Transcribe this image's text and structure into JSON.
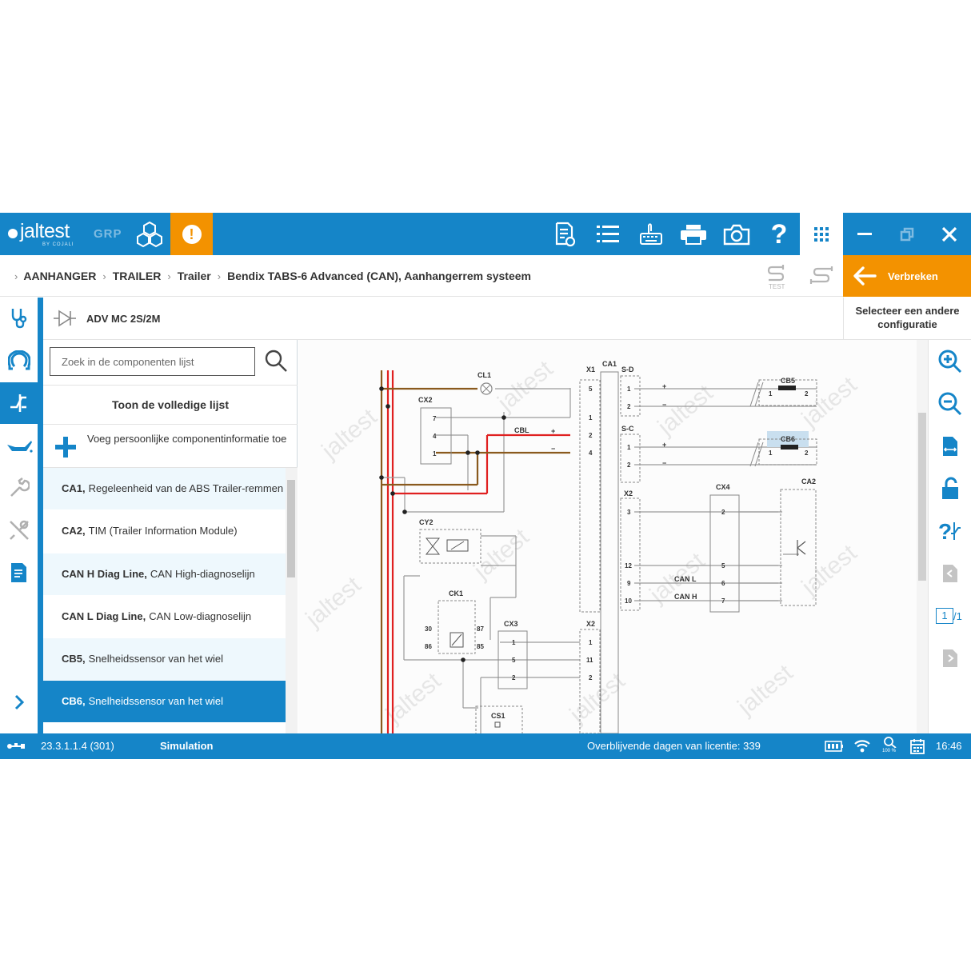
{
  "topbar": {
    "logo_text": "jaltest",
    "logo_sub": "BY COJALI",
    "mode": "GRP",
    "alert_label": "!",
    "help_label": "?"
  },
  "breadcrumb": {
    "items": [
      "AANHANGER",
      "TRAILER",
      "Trailer",
      "Bendix TABS-6 Advanced (CAN), Aanhangerrem systeem"
    ],
    "stest_label": "TEST"
  },
  "disconnect": {
    "label": "Verbreken"
  },
  "config": {
    "label": "Selecteer een andere configuratie"
  },
  "component_header": {
    "title": "ADV MC 2S/2M"
  },
  "search": {
    "placeholder": "Zoek in de componenten lijst"
  },
  "list": {
    "show_all": "Toon de volledige lijst",
    "add_info": "Voeg persoonlijke componentinformatie toe",
    "items": [
      {
        "code": "CA1,",
        "desc": "Regeleenheid van de ABS Trailer-remmen"
      },
      {
        "code": "CA2,",
        "desc": "TIM (Trailer Information Module)"
      },
      {
        "code": "CAN H Diag Line,",
        "desc": "CAN High-diagnoselijn"
      },
      {
        "code": "CAN L Diag Line,",
        "desc": "CAN Low-diagnoselijn"
      },
      {
        "code": "CB5,",
        "desc": "Snelheidssensor van het wiel"
      },
      {
        "code": "CB6,",
        "desc": "Snelheidssensor van het wiel"
      }
    ]
  },
  "diagram": {
    "labels": {
      "cl1": "CL1",
      "cx2": "CX2",
      "cbl": "CBL",
      "x1": "X1",
      "ca1": "CA1",
      "sd": "S-D",
      "cb5": "CB5",
      "sc": "S-C",
      "cb6": "CB6",
      "x2a": "X2",
      "cx4": "CX4",
      "ca2": "CA2",
      "cy2": "CY2",
      "ck1": "CK1",
      "cx3": "CX3",
      "x2b": "X2",
      "cs1": "CS1",
      "canl": "CAN L",
      "canh": "CAN H",
      "plus": "+",
      "minus": "−"
    },
    "pins": {
      "cx2": [
        "7",
        "4",
        "1"
      ],
      "x1": [
        "5",
        "1",
        "2",
        "4"
      ],
      "sd": [
        "1",
        "2"
      ],
      "cb5": [
        "1",
        "2"
      ],
      "sc": [
        "1",
        "2"
      ],
      "cb6": [
        "1",
        "2"
      ],
      "x2a": [
        "3",
        "12",
        "9",
        "10"
      ],
      "cx4": [
        "2",
        "5",
        "6",
        "7"
      ],
      "ck1": [
        "30",
        "86",
        "87",
        "85"
      ],
      "cx3": [
        "1",
        "5",
        "2"
      ],
      "x2b": [
        "1",
        "11",
        "2"
      ]
    }
  },
  "page_indicator": {
    "current": "1",
    "total": "/1"
  },
  "status": {
    "version": "23.3.1.1.4 (301)",
    "mode": "Simulation",
    "license": "Overblijvende dagen van licentie: 339",
    "zoom": "100 %",
    "time": "16:46"
  },
  "colors": {
    "primary": "#1585c8",
    "accent": "#f39200",
    "wire_red": "#e02020",
    "wire_brown": "#8a5a1e"
  }
}
